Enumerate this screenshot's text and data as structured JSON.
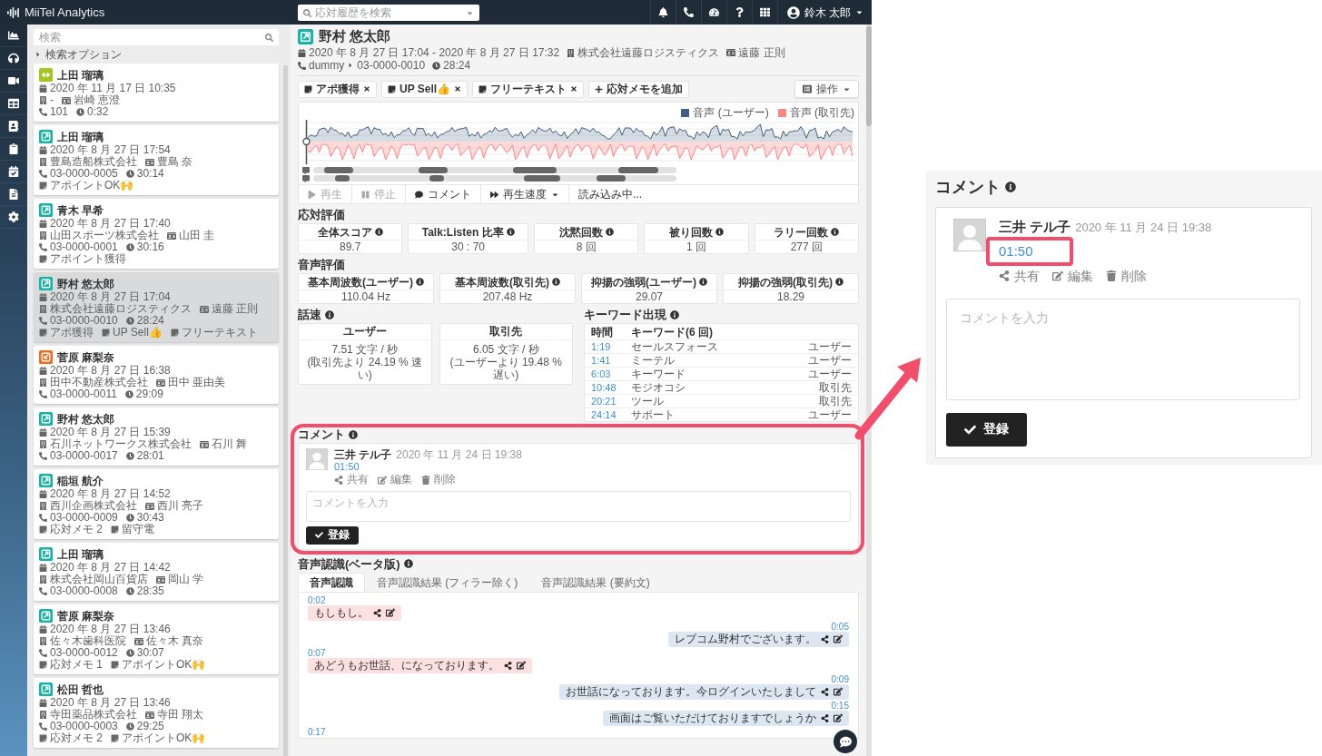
{
  "top_bar": {
    "logo": "MiiTel Analytics",
    "search": {
      "placeholder": "応対履歴を検索"
    },
    "user_name": "鈴木 太郎"
  },
  "call_list": {
    "search": {
      "placeholder": "検索"
    },
    "options_toggle": "検索オプション",
    "items": [
      {
        "kind": "internal",
        "selected": false,
        "name": "上田 瑠璃",
        "date": "2020 年 11 月 17 日 10:35",
        "company": "-",
        "contact": "岩崎 恵澄",
        "phone": "101",
        "duration": "0:32"
      },
      {
        "kind": "outgoing",
        "selected": false,
        "name": "上田 瑠璃",
        "date": "2020 年 8 月 27 日 17:54",
        "company": "豊島造船株式会社",
        "contact": "豊島 奈",
        "phone": "03-0000-0005",
        "duration": "30:14",
        "memos": [
          "アポイントOK🙌"
        ]
      },
      {
        "kind": "outgoing",
        "selected": false,
        "name": "青木 早希",
        "date": "2020 年 8 月 27 日 17:40",
        "company": "山田スポーツ株式会社",
        "contact": "山田 圭",
        "phone": "03-0000-0001",
        "duration": "30:16",
        "memos": [
          "アポイント獲得"
        ]
      },
      {
        "kind": "outgoing",
        "selected": true,
        "name": "野村 悠太郎",
        "date": "2020 年 8 月 27 日 17:04",
        "company": "株式会社遠藤ロジスティクス",
        "contact": "遠藤 正則",
        "phone": "03-0000-0010",
        "duration": "28:24",
        "memos": [
          "アポ獲得",
          "UP Sell👍",
          "フリーテキスト"
        ]
      },
      {
        "kind": "incoming",
        "selected": false,
        "name": "菅原 麻梨奈",
        "date": "2020 年 8 月 27 日 16:38",
        "company": "田中不動産株式会社",
        "contact": "田中 亜由美",
        "phone": "03-0000-0011",
        "duration": "29:09"
      },
      {
        "kind": "outgoing",
        "selected": false,
        "name": "野村 悠太郎",
        "date": "2020 年 8 月 27 日 15:39",
        "company": "石川ネットワークス株式会社",
        "contact": "石川 舞",
        "phone": "03-0000-0017",
        "duration": "28:01"
      },
      {
        "kind": "outgoing",
        "selected": false,
        "name": "稲垣 航介",
        "date": "2020 年 8 月 27 日 14:52",
        "company": "西川企画株式会社",
        "contact": "西川 亮子",
        "phone": "03-0000-0009",
        "duration": "30:43",
        "memos": [
          "応対メモ 2",
          "留守電"
        ]
      },
      {
        "kind": "outgoing",
        "selected": false,
        "name": "上田 瑠璃",
        "date": "2020 年 8 月 27 日 14:42",
        "company": "株式会社岡山百貨店",
        "contact": "岡山 学",
        "phone": "03-0000-0008",
        "duration": "28:35"
      },
      {
        "kind": "outgoing",
        "selected": false,
        "name": "菅原 麻梨奈",
        "date": "2020 年 8 月 27 日 13:46",
        "company": "佐々木歯科医院",
        "contact": "佐々木 真奈",
        "phone": "03-0000-0012",
        "duration": "30:07",
        "memos": [
          "応対メモ 1",
          "アポイントOK🙌"
        ]
      },
      {
        "kind": "outgoing",
        "selected": false,
        "name": "松田 哲也",
        "date": "2020 年 8 月 27 日 13:46",
        "company": "寺田薬品株式会社",
        "contact": "寺田 翔太",
        "phone": "03-0000-0003",
        "duration": "29:25",
        "memos": [
          "応対メモ 2",
          "アポイントOK🙌"
        ]
      }
    ]
  },
  "detail": {
    "kind": "outgoing",
    "title": "野村 悠太郎",
    "meta": {
      "period": "2020 年 8 月 27 日 17:04 - 2020 年 8 月 27 日 17:32",
      "company": "株式会社遠藤ロジスティクス",
      "contact": "遠藤 正則",
      "line": "dummy",
      "phone": "03-0000-0010",
      "duration": "28:24"
    },
    "tags": [
      "アポ獲得",
      "UP Sell👍",
      "フリーテキスト"
    ],
    "add_memo": "応対メモを追加",
    "operations_button": "操作",
    "waveform": {
      "legend": [
        {
          "name": "音声 (ユーザー)",
          "color": "#3e5f80"
        },
        {
          "name": "音声 (取引先)",
          "color": "#ff8585"
        }
      ]
    },
    "player": {
      "controls": [
        {
          "kind": "play",
          "label": "再生",
          "disabled": true
        },
        {
          "kind": "stop",
          "label": "停止",
          "disabled": true
        },
        {
          "kind": "comment",
          "label": "コメント",
          "disabled": false
        },
        {
          "kind": "speed",
          "label": "再生速度",
          "disabled": false
        }
      ],
      "status": "読み込み中..."
    },
    "response_evaluation": {
      "heading": "応対評価",
      "metrics": [
        {
          "label": "全体スコア",
          "value": "89.7"
        },
        {
          "label": "Talk:Listen 比率",
          "value": "30 : 70"
        },
        {
          "label": "沈黙回数",
          "value": "8 回"
        },
        {
          "label": "被り回数",
          "value": "1 回"
        },
        {
          "label": "ラリー回数",
          "value": "277 回"
        }
      ]
    },
    "voice_evaluation": {
      "heading": "音声評価",
      "metrics": [
        {
          "label": "基本周波数(ユーザー)",
          "value": "110.04 Hz"
        },
        {
          "label": "基本周波数(取引先)",
          "value": "207.48 Hz"
        },
        {
          "label": "抑揚の強弱(ユーザー)",
          "value": "29.07"
        },
        {
          "label": "抑揚の強弱(取引先)",
          "value": "18.29"
        }
      ]
    },
    "speech_rate": {
      "heading": "話速",
      "info": true,
      "cards": [
        {
          "label": "ユーザー",
          "rate": "7.51 文字 / 秒",
          "comparison": "(取引先より 24.19 % 速い)"
        },
        {
          "label": "取引先",
          "rate": "6.05 文字 / 秒",
          "comparison": "(ユーザーより 19.48 % 遅い)"
        }
      ]
    },
    "keywords": {
      "heading": "キーワード出現",
      "info": true,
      "columns": [
        "時間",
        "キーワード(6 回)"
      ],
      "rows": [
        {
          "time": "1:19",
          "keyword": "セールスフォース",
          "column_3": "ユーザー"
        },
        {
          "time": "1:41",
          "keyword": "ミーテル",
          "column_3": "ユーザー"
        },
        {
          "time": "6:03",
          "keyword": "キーワード",
          "column_3": "ユーザー"
        },
        {
          "time": "10:48",
          "keyword": "モジオコシ",
          "column_3": "取引先"
        },
        {
          "time": "20:21",
          "keyword": "ツール",
          "column_3": "取引先"
        },
        {
          "time": "24:14",
          "keyword": "サポート",
          "column_3": "ユーザー"
        }
      ]
    },
    "comments": {
      "heading": "コメント",
      "info": true,
      "highlighted": true,
      "items": [
        {
          "author": "三井 テル子",
          "date": "2020 年 11 月 24 日 19:38",
          "time": "01:50",
          "actions": [
            {
              "kind": "share",
              "label": "共有"
            },
            {
              "kind": "edit",
              "label": "編集"
            },
            {
              "kind": "delete",
              "label": "削除"
            }
          ]
        }
      ],
      "input": {
        "placeholder": "コメントを入力"
      },
      "submit": "登録"
    },
    "transcript": {
      "heading": "音声認識(ベータ版)",
      "info": true,
      "tabs": [
        {
          "label": "音声認識",
          "selected": true
        },
        {
          "label": "音声認識結果 (フィラー除く)",
          "selected": false
        },
        {
          "label": "音声認識結果 (要約文)",
          "selected": false
        }
      ],
      "entries": [
        {
          "kind": "client",
          "time": "0:02",
          "text": "もしもし。"
        },
        {
          "kind": "user",
          "time": "0:05",
          "text": "レブコム野村でございます。"
        },
        {
          "kind": "client",
          "time": "0:07",
          "text": "あどうもお世話、になっております。"
        },
        {
          "kind": "user",
          "time": "0:09",
          "text": "お世話になっております。今ログインいたしまして"
        },
        {
          "kind": "user",
          "time": "0:15",
          "text": "画面はご覧いただけておりますでしょうか"
        },
        {
          "kind": "client",
          "time": "0:17"
        }
      ]
    }
  },
  "zoom_panel": {
    "heading": "コメント",
    "info": true,
    "comment": {
      "author": "三井 テル子",
      "date": "2020 年 11 月 24 日 19:38",
      "time": "01:50",
      "time_highlighted": true,
      "actions": [
        {
          "kind": "share",
          "label": "共有"
        },
        {
          "kind": "edit",
          "label": "編集"
        },
        {
          "kind": "delete",
          "label": "削除"
        }
      ]
    },
    "input": {
      "placeholder": "コメントを入力"
    },
    "submit": "登録"
  }
}
